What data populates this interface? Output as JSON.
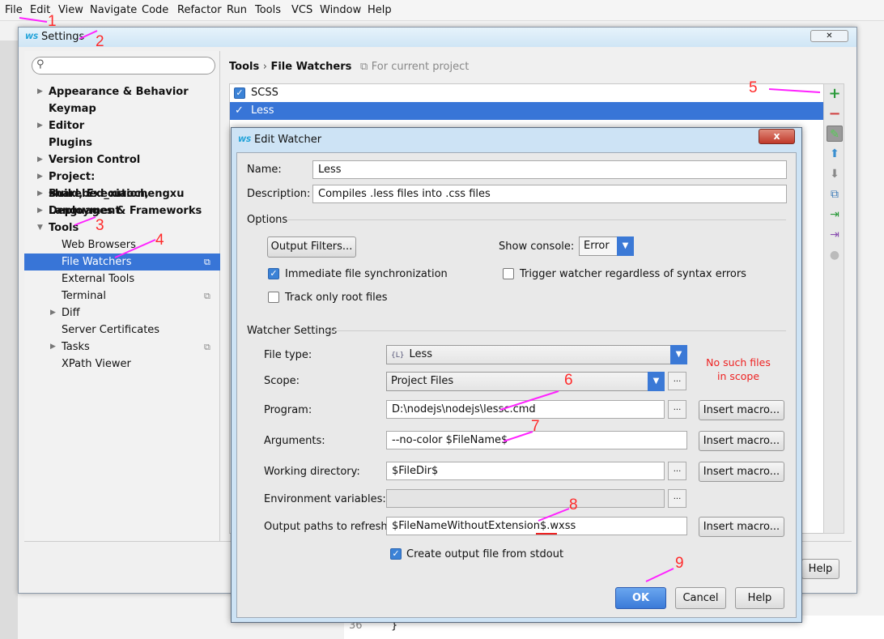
{
  "menubar": [
    "File",
    "Edit",
    "View",
    "Navigate",
    "Code",
    "Refactor",
    "Run",
    "Tools",
    "VCS",
    "Window",
    "Help"
  ],
  "settings": {
    "title": "Settings",
    "close": "✕",
    "breadcrumb": {
      "parent": "Tools",
      "sep": "›",
      "current": "File Watchers",
      "scope": "For current project"
    },
    "tree": [
      {
        "label": "Appearance & Behavior",
        "bold": true,
        "arrow": "▶",
        "level": 0
      },
      {
        "label": "Keymap",
        "bold": true,
        "level": 0
      },
      {
        "label": "Editor",
        "bold": true,
        "arrow": "▶",
        "level": 0
      },
      {
        "label": "Plugins",
        "bold": true,
        "level": 0
      },
      {
        "label": "Version Control",
        "bold": true,
        "arrow": "▶",
        "level": 0
      },
      {
        "label": "Project: sharebed_xiaochengxu",
        "bold": true,
        "arrow": "▶",
        "level": 0
      },
      {
        "label": "Build, Execution, Deployment",
        "bold": true,
        "arrow": "▶",
        "level": 0
      },
      {
        "label": "Languages & Frameworks",
        "bold": true,
        "arrow": "▶",
        "level": 0
      },
      {
        "label": "Tools",
        "bold": true,
        "arrow": "▼",
        "level": 0
      },
      {
        "label": "Web Browsers",
        "level": 1
      },
      {
        "label": "File Watchers",
        "level": 1,
        "selected": true,
        "project_icon": true
      },
      {
        "label": "External Tools",
        "level": 1
      },
      {
        "label": "Terminal",
        "level": 1,
        "project_icon": true
      },
      {
        "label": "Diff",
        "level": 1,
        "arrow": "▶"
      },
      {
        "label": "Server Certificates",
        "level": 1
      },
      {
        "label": "Tasks",
        "level": 1,
        "arrow": "▶",
        "project_icon": true
      },
      {
        "label": "XPath Viewer",
        "level": 1
      }
    ],
    "watchers": [
      {
        "label": "SCSS",
        "checked": true
      },
      {
        "label": "Less",
        "checked": true,
        "selected": true
      }
    ],
    "toolbar": [
      "add-icon",
      "remove-icon",
      "edit-icon",
      "move-up-icon",
      "move-down-icon",
      "copy-icon",
      "import-icon",
      "export-icon",
      "disabled-icon"
    ],
    "help_label": "Help"
  },
  "dialog": {
    "title": "Edit Watcher",
    "close": "x",
    "name_label": "Name:",
    "name_value": "Less",
    "description_label": "Description:",
    "description_value": "Compiles .less files into .css files",
    "options_header": "Options",
    "output_filters": "Output Filters...",
    "show_console_label": "Show console:",
    "show_console_value": "Error",
    "immediate_sync": {
      "label": "Immediate file synchronization",
      "checked": true
    },
    "trigger_watcher": {
      "label": "Trigger watcher regardless of syntax errors",
      "checked": false
    },
    "track_root": {
      "label": "Track only root files",
      "checked": false
    },
    "watcher_settings_header": "Watcher Settings",
    "file_type_label": "File type:",
    "file_type_value": "Less",
    "scope_label": "Scope:",
    "scope_value": "Project Files",
    "scope_warning": "No such files in scope",
    "program_label": "Program:",
    "program_value": "D:\\nodejs\\nodejs\\lessc.cmd",
    "arguments_label": "Arguments:",
    "arguments_value": "--no-color $FileName$",
    "working_dir_label": "Working directory:",
    "working_dir_value": "$FileDir$",
    "env_label": "Environment variables:",
    "env_value": "",
    "output_paths_label": "Output paths to refresh:",
    "output_paths_value": "$FileNameWithoutExtension$.wxss",
    "create_output": {
      "label": "Create output file from stdout",
      "checked": true
    },
    "insert_macro": "Insert macro...",
    "browse": "...",
    "ok": "OK",
    "cancel": "Cancel",
    "help": "Help"
  },
  "background": {
    "line_number": "36",
    "code": "}"
  },
  "annotations": [
    "1",
    "2",
    "3",
    "4",
    "5",
    "6",
    "7",
    "8",
    "9"
  ],
  "colors": {
    "selection": "#3875d7",
    "annotation_text": "#ff2a2a",
    "annotation_arrow": "#ff22ff"
  }
}
